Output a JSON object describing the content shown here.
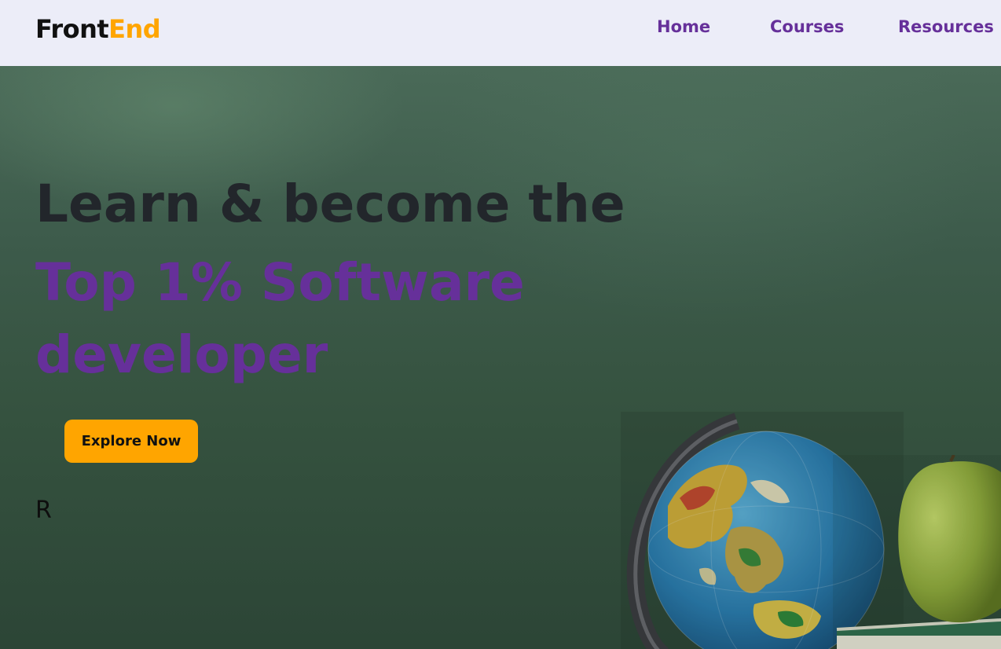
{
  "brand": {
    "part1": "Front",
    "part2": "End",
    "accent_color": "#ffa500",
    "primary_color": "#66309a"
  },
  "nav": {
    "items": [
      {
        "label": "Home"
      },
      {
        "label": "Courses"
      },
      {
        "label": "Resources"
      }
    ]
  },
  "hero": {
    "headline": "Learn & become the",
    "subheadline": "Top 1% Software developer",
    "cta_label": "Explore Now",
    "typed_text": "R"
  },
  "icons": [
    "globe-image",
    "apple-image",
    "book-image"
  ]
}
